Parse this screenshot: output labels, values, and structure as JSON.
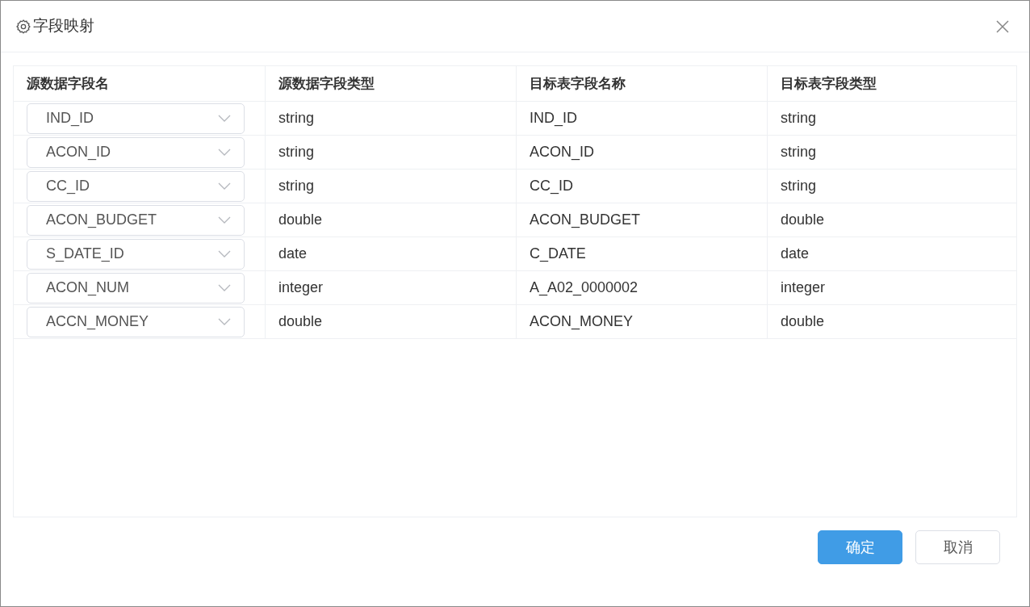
{
  "window": {
    "title": "字段映射"
  },
  "table": {
    "columns": [
      "源数据字段名",
      "源数据字段类型",
      "目标表字段名称",
      "目标表字段类型"
    ],
    "rows": [
      {
        "source_field": "IND_ID",
        "source_type": "string",
        "target_field": "IND_ID",
        "target_type": "string"
      },
      {
        "source_field": "ACON_ID",
        "source_type": "string",
        "target_field": "ACON_ID",
        "target_type": "string"
      },
      {
        "source_field": "CC_ID",
        "source_type": "string",
        "target_field": "CC_ID",
        "target_type": "string"
      },
      {
        "source_field": "ACON_BUDGET",
        "source_type": "double",
        "target_field": "ACON_BUDGET",
        "target_type": "double"
      },
      {
        "source_field": "S_DATE_ID",
        "source_type": "date",
        "target_field": "C_DATE",
        "target_type": "date"
      },
      {
        "source_field": "ACON_NUM",
        "source_type": "integer",
        "target_field": "A_A02_0000002",
        "target_type": "integer"
      },
      {
        "source_field": "ACCN_MONEY",
        "source_type": "double",
        "target_field": "ACON_MONEY",
        "target_type": "double"
      }
    ]
  },
  "buttons": [
    {
      "label": "确定",
      "kind": "primary"
    },
    {
      "label": "取消",
      "kind": "secondary"
    }
  ]
}
